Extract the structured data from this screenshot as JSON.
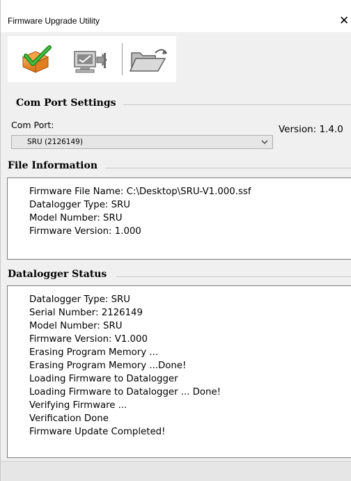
{
  "window": {
    "title": "Firmware Upgrade Utility",
    "close_glyph": "✕"
  },
  "toolbar": {
    "buttons": [
      {
        "icon": "upgrade-firmware-icon"
      },
      {
        "icon": "connect-datalogger-icon"
      },
      {
        "icon": "open-folder-icon"
      }
    ]
  },
  "com_port_settings": {
    "title": "Com Port Settings",
    "com_port_label": "Com Port:",
    "selected_port": "SRU (2126149)",
    "version_text": "Version: 1.4.0"
  },
  "file_information": {
    "title": "File Information",
    "lines": [
      "Firmware File Name: C:\\Desktop\\SRU-V1.000.ssf",
      "Datalogger Type: SRU",
      "Model Number: SRU",
      "Firmware Version: 1.000"
    ]
  },
  "datalogger_status": {
    "title": "Datalogger Status",
    "lines": [
      "Datalogger Type: SRU",
      "Serial Number: 2126149",
      "Model Number: SRU",
      "Firmware Version: V1.000",
      "Erasing Program Memory ...",
      "Erasing Program Memory ...Done!",
      "Loading Firmware to Datalogger",
      "Loading Firmware to Datalogger ... Done!",
      "Verifying Firmware ...",
      "Verification Done",
      "Firmware Update Completed!"
    ]
  },
  "colors": {
    "background": "#f0f0f0",
    "textbox_background": "#ffffff",
    "check_green": "#1f8a1f",
    "folder_orange": "#e8872a"
  }
}
